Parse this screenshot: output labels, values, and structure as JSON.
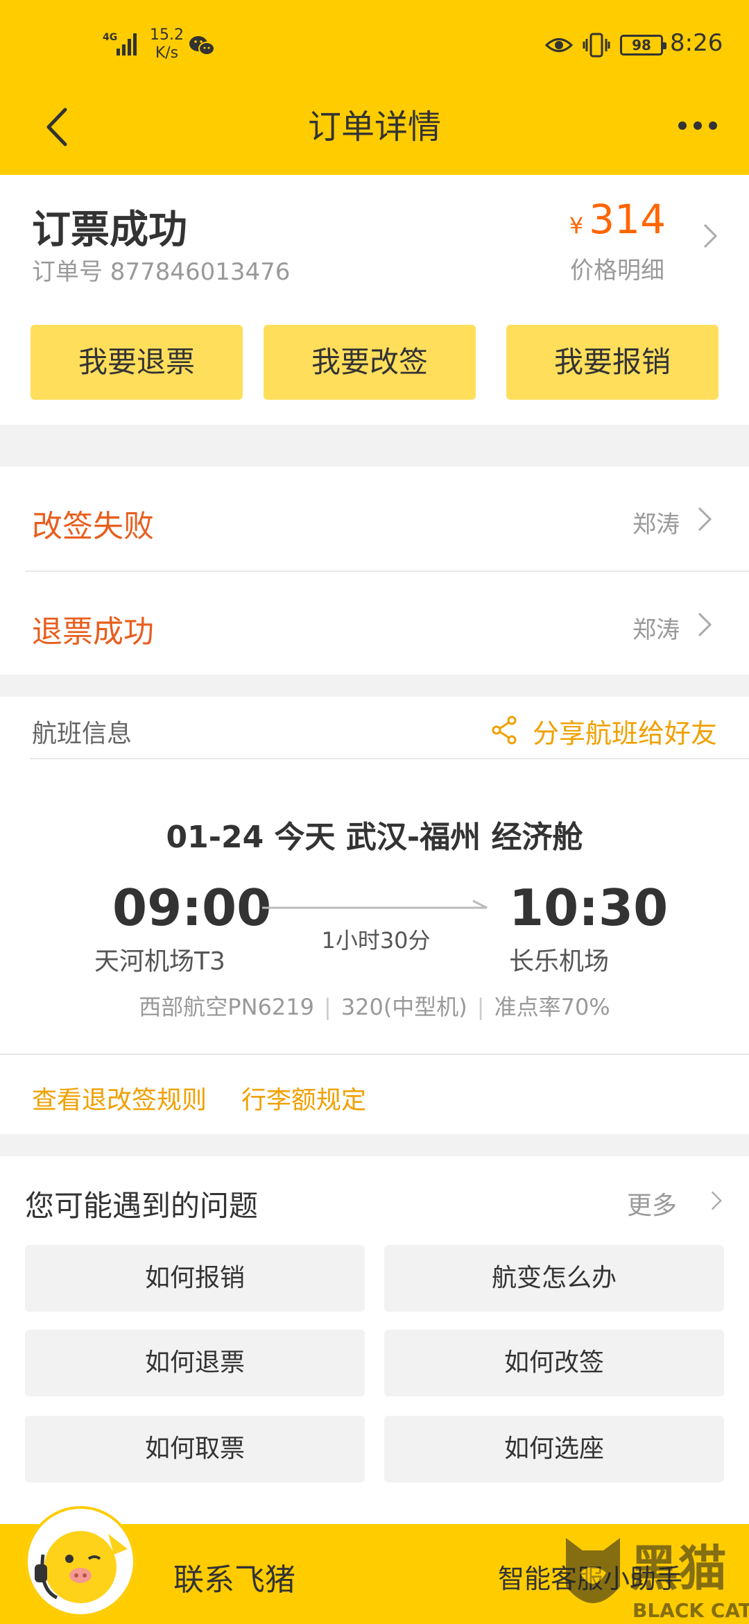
{
  "status_bar": {
    "network": "4G",
    "speed_value": "15.2",
    "speed_unit": "K/s",
    "battery": "98",
    "time": "8:26"
  },
  "header": {
    "title": "订单详情"
  },
  "order": {
    "status": "订票成功",
    "order_no": "订单号 877846013476",
    "currency": "¥",
    "price": "314",
    "price_detail": "价格明细",
    "buttons": [
      "我要退票",
      "我要改签",
      "我要报销"
    ]
  },
  "changes": [
    {
      "label": "改签失败",
      "person": "郑涛"
    },
    {
      "label": "退票成功",
      "person": "郑涛"
    }
  ],
  "flight": {
    "section_label": "航班信息",
    "share_label": "分享航班给好友",
    "route_line": "01-24  今天  武汉-福州  经济舱",
    "dep_time": "09:00",
    "arr_time": "10:30",
    "duration": "1小时30分",
    "dep_airport": "天河机场T3",
    "arr_airport": "长乐机场",
    "airline": "西部航空PN6219",
    "aircraft": "320(中型机)",
    "punctuality": "准点率70%",
    "rules_link": "查看退改签规则",
    "baggage_link": "行李额规定"
  },
  "faq": {
    "title": "您可能遇到的问题",
    "more": "更多",
    "items": [
      "如何报销",
      "航变怎么办",
      "如何退票",
      "如何改签",
      "如何取票",
      "如何选座"
    ]
  },
  "bottom": {
    "contact": "联系飞猪",
    "assistant": "智能客服小助手",
    "watermark_text": "黑猫",
    "watermark_sub": "BLACK CAT"
  },
  "colors": {
    "brand_yellow": "#ffcc00",
    "button_yellow": "#ffde5c",
    "price_orange": "#ff6600",
    "status_orange": "#e85e1e",
    "link_orange": "#f0a000"
  }
}
